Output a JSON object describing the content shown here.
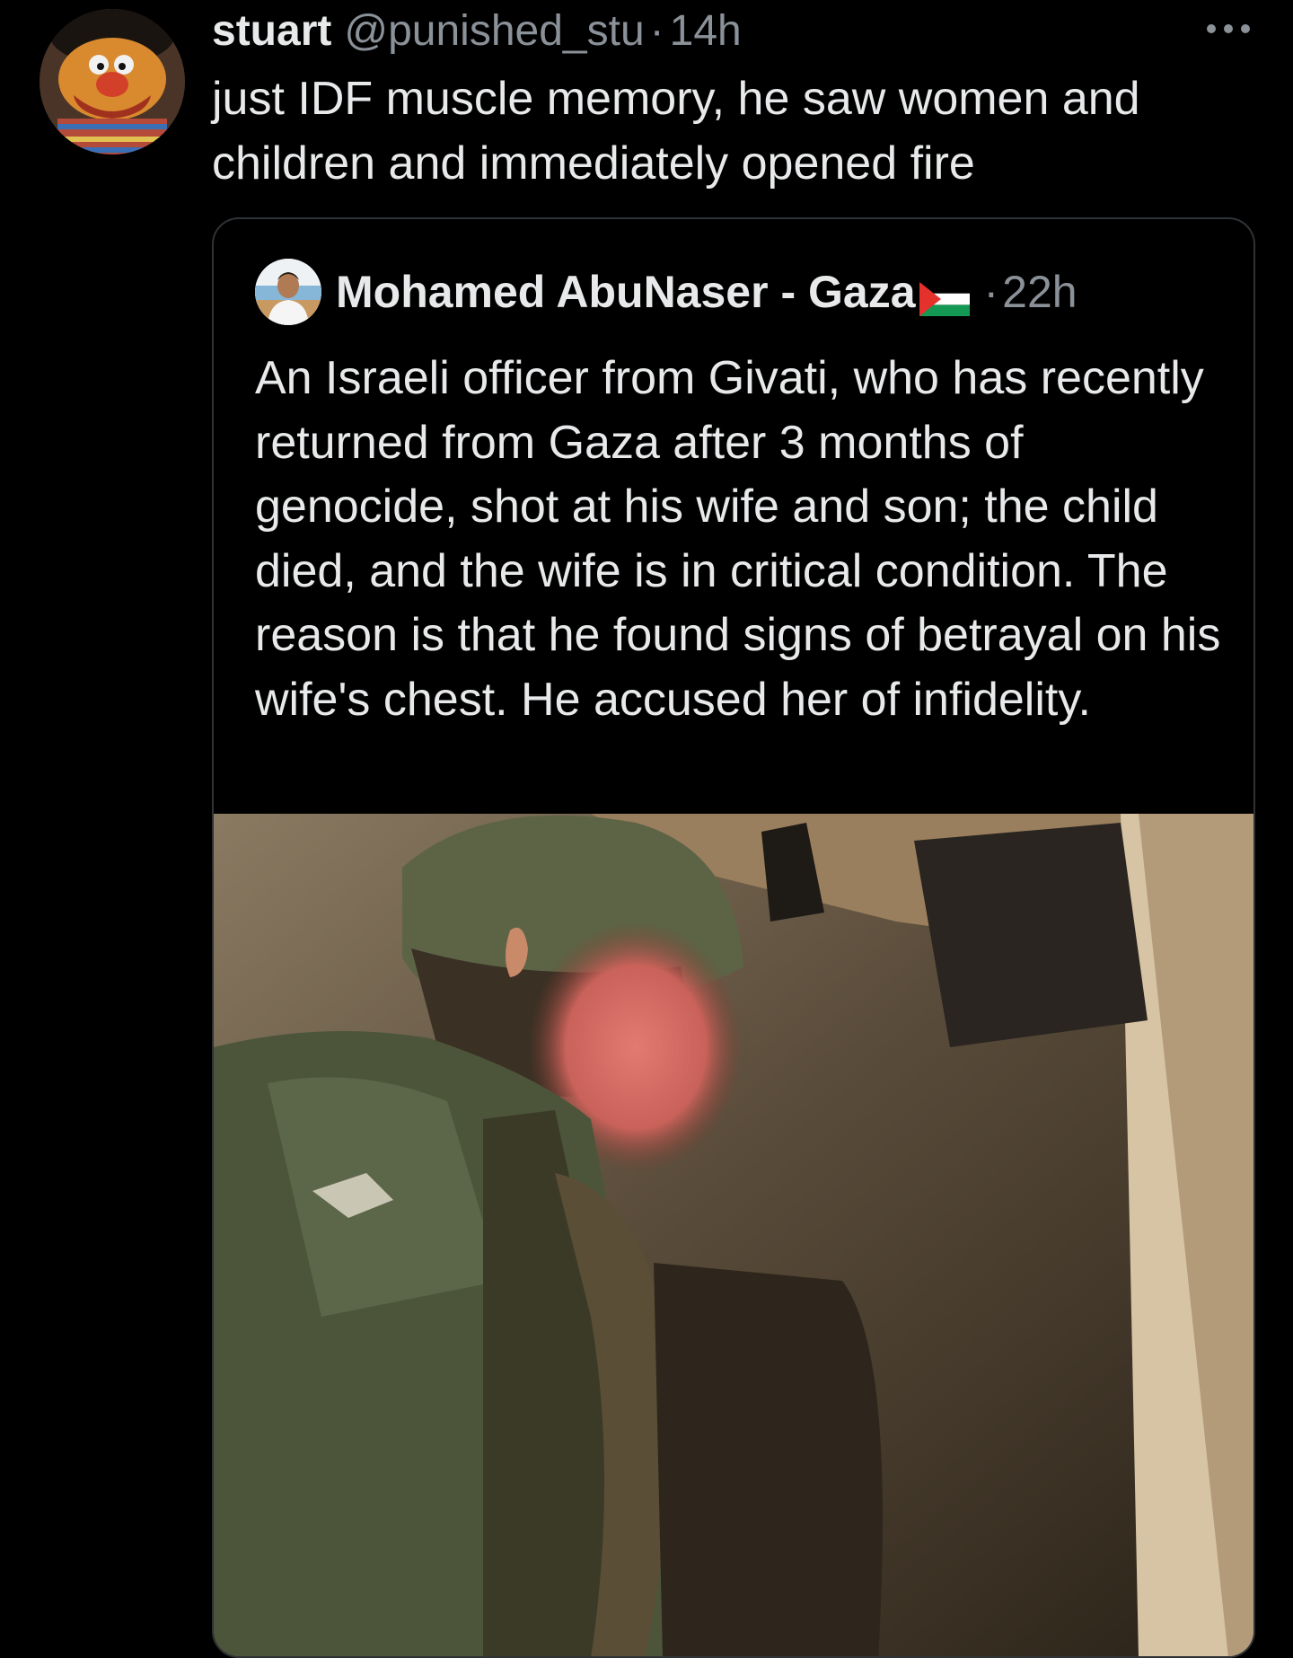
{
  "tweet": {
    "display_name": "stuart",
    "handle": "@punished_stu",
    "separator": "·",
    "time": "14h",
    "text": "just IDF muscle memory, he saw women and children and immediately opened fire",
    "more_icon": "more-horizontal-icon"
  },
  "quoted_tweet": {
    "display_name": "Mohamed AbuNaser - Gaza",
    "flag_icon": "palestine-flag-icon",
    "separator": "·",
    "time": "22h",
    "text": "An Israeli officer from Givati, who has recently returned from Gaza after 3 months of genocide, shot at his wife and son; the child died, and the wife is in critical condition. The reason is that  he found signs of betrayal on his wife's chest. He accused her of infidelity."
  },
  "colors": {
    "background": "#000000",
    "primary_text": "#e7e9ea",
    "secondary_text": "#8b9198",
    "border": "#2f3336"
  }
}
